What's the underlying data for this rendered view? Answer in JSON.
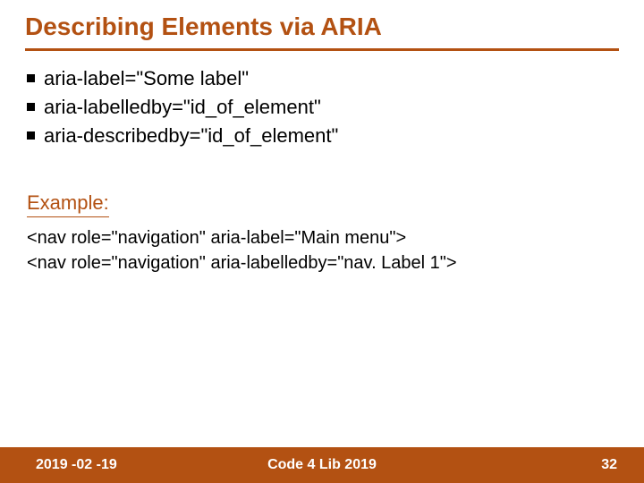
{
  "title": "Describing Elements via ARIA",
  "bullets": [
    "aria-label=\"Some label\"",
    "aria-labelledby=\"id_of_element\"",
    "aria-describedby=\"id_of_element\""
  ],
  "example_label": "Example:",
  "code_lines": [
    "<nav role=\"navigation\" aria-label=\"Main menu\">",
    "<nav role=\"navigation\" aria-labelledby=\"nav. Label 1\">"
  ],
  "footer": {
    "date": "2019 -02 -19",
    "conference": "Code 4 Lib 2019",
    "page": "32"
  }
}
